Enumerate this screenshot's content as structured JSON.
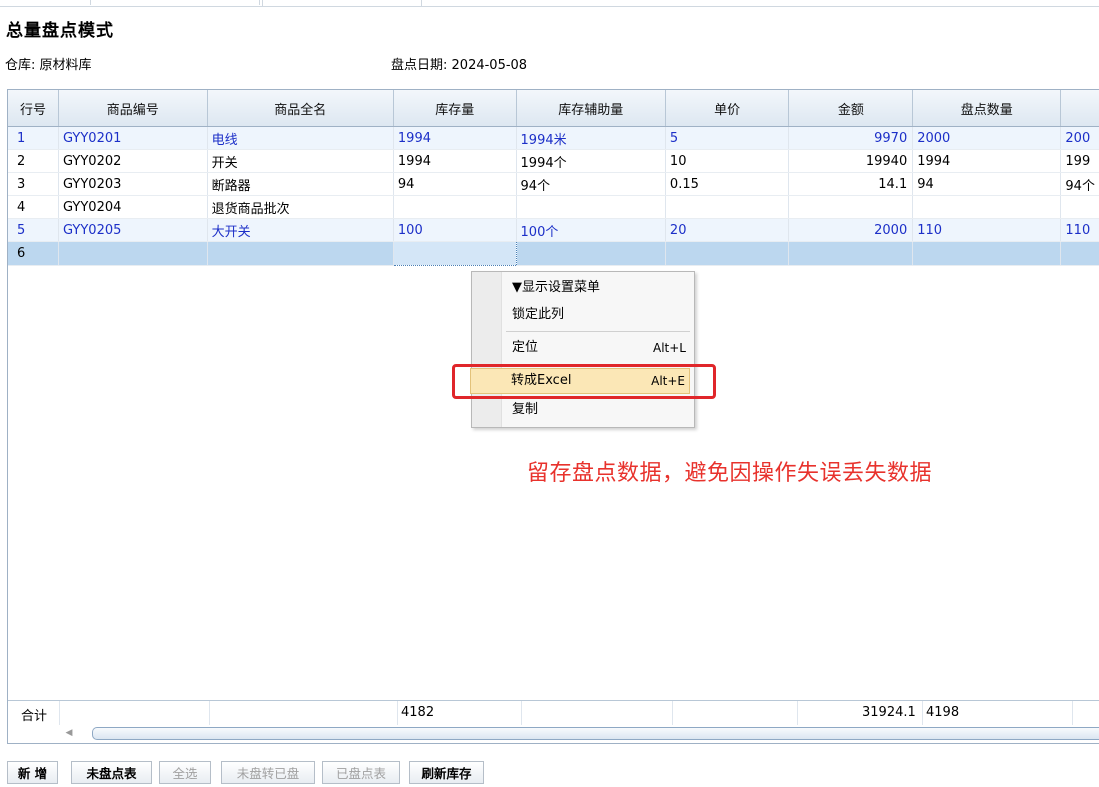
{
  "page": {
    "title": "总量盘点模式",
    "warehouse_label": "仓库:",
    "warehouse_value": "原材料库",
    "date_label": "盘点日期:",
    "date_value": "2024-05-08"
  },
  "grid": {
    "headers": [
      "行号",
      "商品编号",
      "商品全名",
      "库存量",
      "库存辅助量",
      "单价",
      "金额",
      "盘点数量",
      ""
    ],
    "rows": [
      {
        "rn": "1",
        "code": "GYY0201",
        "name": "电线",
        "qty": "1994",
        "aux": "1994米",
        "price": "5",
        "amount": "9970",
        "count": "2000",
        "extra": "200"
      },
      {
        "rn": "2",
        "code": "GYY0202",
        "name": "开关",
        "qty": "1994",
        "aux": "1994个",
        "price": "10",
        "amount": "19940",
        "count": "1994",
        "extra": "199"
      },
      {
        "rn": "3",
        "code": "GYY0203",
        "name": "断路器",
        "qty": "94",
        "aux": "94个",
        "price": "0.15",
        "amount": "14.1",
        "count": "94",
        "extra": "94个"
      },
      {
        "rn": "4",
        "code": "GYY0204",
        "name": "退货商品批次",
        "qty": "",
        "aux": "",
        "price": "",
        "amount": "",
        "count": "",
        "extra": ""
      },
      {
        "rn": "5",
        "code": "GYY0205",
        "name": "大开关",
        "qty": "100",
        "aux": "100个",
        "price": "20",
        "amount": "2000",
        "count": "110",
        "extra": "110"
      },
      {
        "rn": "6",
        "code": "",
        "name": "",
        "qty": "",
        "aux": "",
        "price": "",
        "amount": "",
        "count": "",
        "extra": ""
      }
    ],
    "totals": {
      "label": "合计",
      "qty": "4182",
      "amount": "31924.1",
      "count": "4198"
    }
  },
  "context_menu": {
    "items": [
      {
        "label": "▼显示设置菜单",
        "shortcut": ""
      },
      {
        "label": "锁定此列",
        "shortcut": ""
      },
      {
        "label": "定位",
        "shortcut": "Alt+L"
      },
      {
        "label": "转成Excel",
        "shortcut": "Alt+E"
      },
      {
        "label": "复制",
        "shortcut": ""
      }
    ]
  },
  "annotation": "留存盘点数据，避免因操作失误丢失数据",
  "buttons": [
    {
      "label": "新 增",
      "enabled": true
    },
    {
      "label": "未盘点表",
      "enabled": true
    },
    {
      "label": "全选",
      "enabled": false
    },
    {
      "label": "未盘转已盘",
      "enabled": false
    },
    {
      "label": "已盘点表",
      "enabled": false
    },
    {
      "label": "刷新库存",
      "enabled": true
    }
  ],
  "colors": {
    "row_link_blue": "#1c2fc8",
    "highlight_red": "#e0262a",
    "menu_highlight": "#fbe7b6"
  }
}
